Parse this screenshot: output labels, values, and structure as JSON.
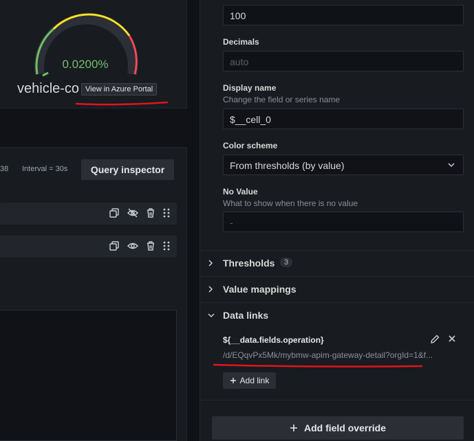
{
  "gauge": {
    "value": "0.0200%",
    "label": "vehicle-co",
    "tooltip": "View in Azure Portal",
    "colors": {
      "green": "#73bf69",
      "yellow": "#fade2a",
      "red": "#f2495c"
    }
  },
  "query": {
    "stat_fragment": "38",
    "interval": "Interval = 30s",
    "inspector_label": "Query inspector"
  },
  "fields": {
    "max_value": "100",
    "decimals_label": "Decimals",
    "decimals_placeholder": "auto",
    "display_name_label": "Display name",
    "display_name_desc": "Change the field or series name",
    "display_name_value": "$__cell_0",
    "color_scheme_label": "Color scheme",
    "color_scheme_value": "From thresholds (by value)",
    "no_value_label": "No Value",
    "no_value_desc": "What to show when there is no value",
    "no_value_placeholder": "-"
  },
  "sections": {
    "thresholds": "Thresholds",
    "thresholds_count": "3",
    "value_mappings": "Value mappings",
    "data_links": "Data links"
  },
  "data_link": {
    "title": "${__data.fields.operation}",
    "url": "/d/EQqvPx5Mk/mybmw-apim-gateway-detail?orgId=1&f...",
    "add_link_label": "Add link"
  },
  "add_override_label": "Add field override"
}
